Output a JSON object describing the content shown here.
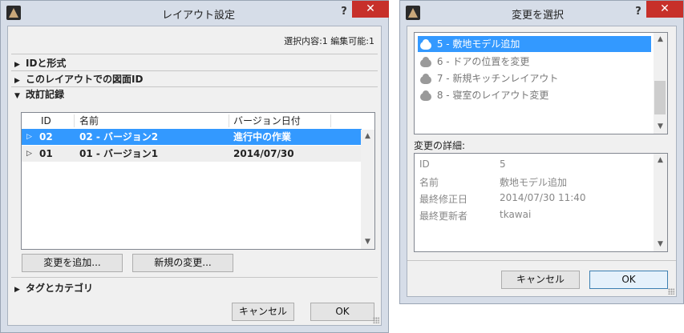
{
  "layout_dialog": {
    "title": "レイアウト設定",
    "help": "?",
    "close": "✕",
    "status": "選択内容:1 編集可能:1",
    "sections": {
      "id_format": "IDと形式",
      "drawing_id": "このレイアウトでの図面ID",
      "revision": "改訂記録",
      "tags": "タグとカテゴリ"
    },
    "table": {
      "headers": [
        "ID",
        "名前",
        "バージョン日付"
      ],
      "rows": [
        {
          "id": "02",
          "name": "02 - バージョン2",
          "date": "進行中の作業"
        },
        {
          "id": "01",
          "name": "01 - バージョン1",
          "date": "2014/07/30"
        }
      ]
    },
    "add_change_label": "変更を追加...",
    "new_change_label": "新規の変更...",
    "cancel_label": "キャンセル",
    "ok_label": "OK"
  },
  "change_dialog": {
    "title": "変更を選択",
    "help": "?",
    "close": "✕",
    "items": [
      "5 - 敷地モデル追加",
      "6 - ドアの位置を変更",
      "7 - 新規キッチンレイアウト",
      "8 - 寝室のレイアウト変更"
    ],
    "details_heading": "変更の詳細:",
    "details": [
      {
        "label": "ID",
        "value": "5"
      },
      {
        "label": "名前",
        "value": "敷地モデル追加"
      },
      {
        "label": "最終修正日",
        "value": "2014/07/30 11:40"
      },
      {
        "label": "最終更新者",
        "value": "tkawai"
      }
    ],
    "cancel_label": "キャンセル",
    "ok_label": "OK"
  }
}
